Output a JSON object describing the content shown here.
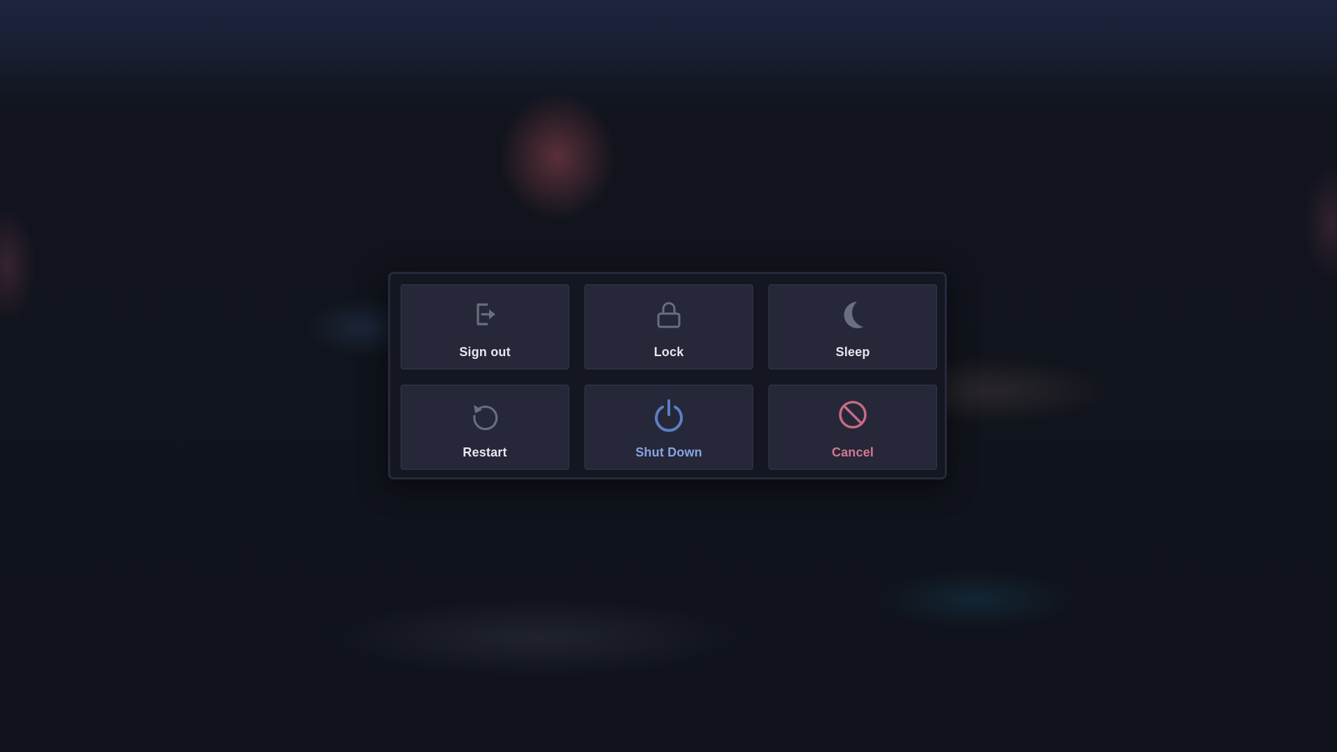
{
  "colors": {
    "dialog_bg": "#141722",
    "tile_bg": "#262839",
    "icon_gray": "#6b6e7e",
    "shutdown_accent": "#5b7fc4",
    "shutdown_label": "#88a4e0",
    "cancel_accent": "#c76a85",
    "cancel_label": "#d4788f",
    "label_default": "#e6e8f0"
  },
  "dialog": {
    "tiles": [
      {
        "id": "sign-out",
        "label": "Sign out",
        "icon": "sign-out-icon"
      },
      {
        "id": "lock",
        "label": "Lock",
        "icon": "lock-icon"
      },
      {
        "id": "sleep",
        "label": "Sleep",
        "icon": "moon-icon"
      },
      {
        "id": "restart",
        "label": "Restart",
        "icon": "restart-icon"
      },
      {
        "id": "shut-down",
        "label": "Shut Down",
        "icon": "power-icon"
      },
      {
        "id": "cancel",
        "label": "Cancel",
        "icon": "cancel-icon"
      }
    ]
  }
}
